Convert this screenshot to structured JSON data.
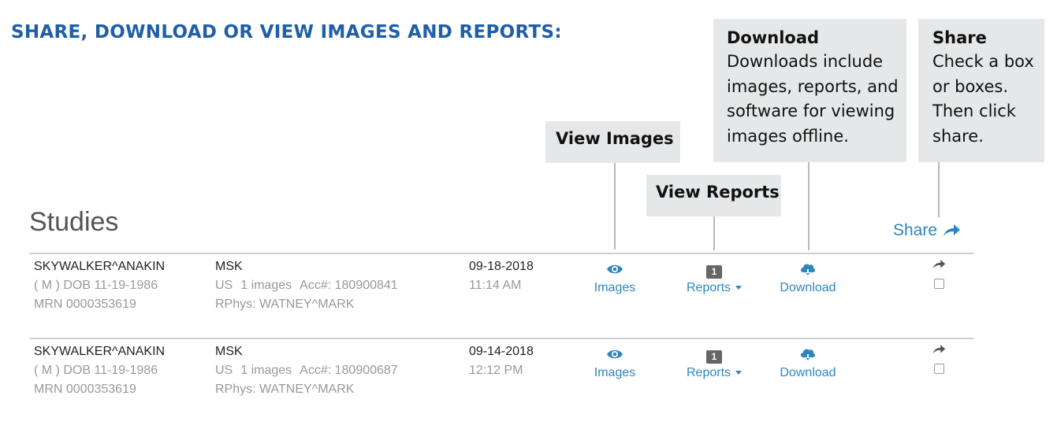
{
  "heading": "SHARE, DOWNLOAD OR VIEW IMAGES AND REPORTS:",
  "callouts": {
    "view_images": {
      "title": "View Images"
    },
    "view_reports": {
      "title": "View Reports"
    },
    "download": {
      "title": "Download",
      "lines": [
        "Downloads include",
        "images, reports, and",
        "software for viewing",
        "images offline."
      ]
    },
    "share": {
      "title": "Share",
      "lines": [
        "Check a box",
        "or boxes.",
        "Then click",
        "share."
      ]
    }
  },
  "studies": {
    "title": "Studies",
    "share_label": "Share",
    "rows": [
      {
        "patient_name": "SKYWALKER^ANAKIN",
        "patient_dob": "( M ) DOB 11-19-1986",
        "patient_mrn": "MRN 0000353619",
        "study_desc": "MSK",
        "modality": "US",
        "image_count": "1 images",
        "accession": "Acc#: 180900841",
        "rphys": "RPhys: WATNEY^MARK",
        "date": "09-18-2018",
        "time": "11:14 AM",
        "images_label": "Images",
        "report_count": "1",
        "reports_label": "Reports",
        "download_label": "Download"
      },
      {
        "patient_name": "SKYWALKER^ANAKIN",
        "patient_dob": "( M ) DOB 11-19-1986",
        "patient_mrn": "MRN 0000353619",
        "study_desc": "MSK",
        "modality": "US",
        "image_count": "1 images",
        "accession": "Acc#: 180900687",
        "rphys": "RPhys: WATNEY^MARK",
        "date": "09-14-2018",
        "time": "12:12 PM",
        "images_label": "Images",
        "report_count": "1",
        "reports_label": "Reports",
        "download_label": "Download"
      }
    ]
  },
  "colors": {
    "heading": "#1f5fa8",
    "link": "#2e86c1",
    "callout_bg": "#e6e7e8"
  },
  "icons": {
    "images": "eye-icon",
    "download": "cloud-download-icon",
    "share": "share-arrow-icon"
  }
}
